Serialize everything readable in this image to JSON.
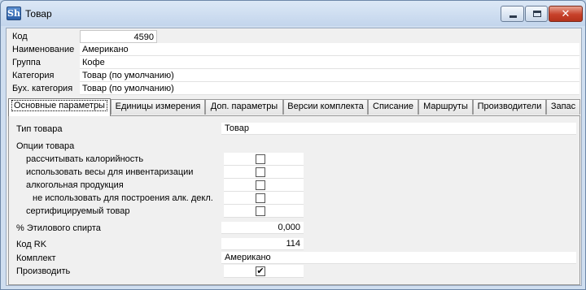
{
  "window": {
    "title": "Товар",
    "app_icon": "Sh",
    "close_glyph": "✕"
  },
  "header_fields": [
    {
      "label": "Код",
      "value": "4590"
    },
    {
      "label": "Наименование",
      "value": "Американо"
    },
    {
      "label": "Группа",
      "value": "Кофе"
    },
    {
      "label": "Категория",
      "value": "Товар (по умолчанию)"
    },
    {
      "label": "Бух. категория",
      "value": "Товар (по умолчанию)"
    }
  ],
  "tabs": [
    {
      "label": "Основные параметры",
      "active": true
    },
    {
      "label": "Единицы измерения"
    },
    {
      "label": "Доп. параметры"
    },
    {
      "label": "Версии комплекта"
    },
    {
      "label": "Списание"
    },
    {
      "label": "Маршруты"
    },
    {
      "label": "Производители"
    },
    {
      "label": "Запас"
    }
  ],
  "main": {
    "product_type_label": "Тип товара",
    "product_type_value": "Товар",
    "options_heading": "Опции товара",
    "options": [
      {
        "label": "рассчитывать калорийность",
        "checked": false
      },
      {
        "label": "использовать весы для инвентаризации",
        "checked": false
      },
      {
        "label": "алкогольная продукция",
        "checked": false
      },
      {
        "label": "не использовать для  построения алк. декл.",
        "checked": false
      },
      {
        "label": "сертифицируемый товар",
        "checked": false
      }
    ],
    "alcohol_label": "% Этилового спирта",
    "alcohol_value": "0,000",
    "rk_code_label": "Код RK",
    "rk_code_value": "114",
    "kit_label": "Комплект",
    "kit_value": "Американо",
    "produce_label": "Производить",
    "produce_checked": true,
    "check_glyph": "✔"
  }
}
